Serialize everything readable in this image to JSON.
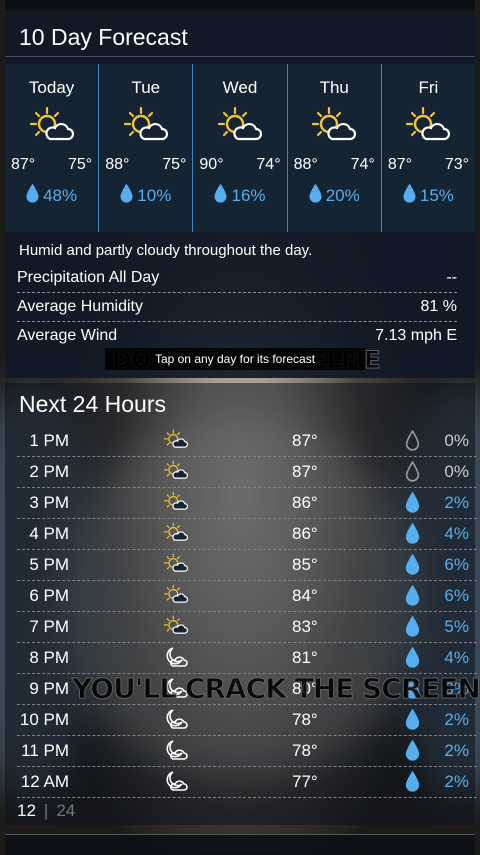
{
  "forecast": {
    "title": "10 Day Forecast",
    "days": [
      {
        "name": "Today",
        "high": "87°",
        "low": "75°",
        "precip": "48%",
        "icon": "partly-sunny-icon"
      },
      {
        "name": "Tue",
        "high": "88°",
        "low": "75°",
        "precip": "10%",
        "icon": "partly-sunny-icon"
      },
      {
        "name": "Wed",
        "high": "90°",
        "low": "74°",
        "precip": "16%",
        "icon": "partly-sunny-icon"
      },
      {
        "name": "Thu",
        "high": "88°",
        "low": "74°",
        "precip": "20%",
        "icon": "partly-sunny-icon"
      },
      {
        "name": "Fri",
        "high": "87°",
        "low": "73°",
        "precip": "15%",
        "icon": "partly-sunny-icon"
      }
    ],
    "summary": "Humid and partly cloudy throughout the day.",
    "stats": [
      {
        "label": "Precipitation All Day",
        "value": "--"
      },
      {
        "label": "Average Humidity",
        "value": "81 %"
      },
      {
        "label": "Average Wind",
        "value": "7.13 mph E"
      }
    ],
    "tap_hint": "Tap on any day for its forecast"
  },
  "meme": {
    "top": "DON'T TAKE A SELFIE",
    "bottom": "YOU'LL CRACK THE SCREEN"
  },
  "hours": {
    "title": "Next 24 Hours",
    "rows": [
      {
        "time": "1 PM",
        "temp": "87°",
        "precip": "0%",
        "icon": "partly-sunny-icon",
        "drop": "empty"
      },
      {
        "time": "2 PM",
        "temp": "87°",
        "precip": "0%",
        "icon": "partly-sunny-icon",
        "drop": "empty"
      },
      {
        "time": "3 PM",
        "temp": "86°",
        "precip": "2%",
        "icon": "partly-sunny-icon",
        "drop": "filled"
      },
      {
        "time": "4 PM",
        "temp": "86°",
        "precip": "4%",
        "icon": "partly-sunny-icon",
        "drop": "filled"
      },
      {
        "time": "5 PM",
        "temp": "85°",
        "precip": "6%",
        "icon": "partly-sunny-icon",
        "drop": "filled"
      },
      {
        "time": "6 PM",
        "temp": "84°",
        "precip": "6%",
        "icon": "partly-sunny-icon",
        "drop": "filled"
      },
      {
        "time": "7 PM",
        "temp": "83°",
        "precip": "5%",
        "icon": "partly-sunny-icon",
        "drop": "filled"
      },
      {
        "time": "8 PM",
        "temp": "81°",
        "precip": "4%",
        "icon": "moon-cloud-icon",
        "drop": "filled"
      },
      {
        "time": "9 PM",
        "temp": "80°",
        "precip": "3%",
        "icon": "moon-cloud-icon",
        "drop": "filled"
      },
      {
        "time": "10 PM",
        "temp": "78°",
        "precip": "2%",
        "icon": "moon-cloud-icon",
        "drop": "filled"
      },
      {
        "time": "11 PM",
        "temp": "78°",
        "precip": "2%",
        "icon": "moon-cloud-icon",
        "drop": "filled"
      },
      {
        "time": "12 AM",
        "temp": "77°",
        "precip": "2%",
        "icon": "moon-cloud-icon",
        "drop": "filled"
      }
    ],
    "toggle": {
      "active": "12",
      "inactive": "24"
    }
  },
  "colors": {
    "accent": "#3f86c9",
    "precip": "#56aef0",
    "sun": "#f2c230"
  }
}
